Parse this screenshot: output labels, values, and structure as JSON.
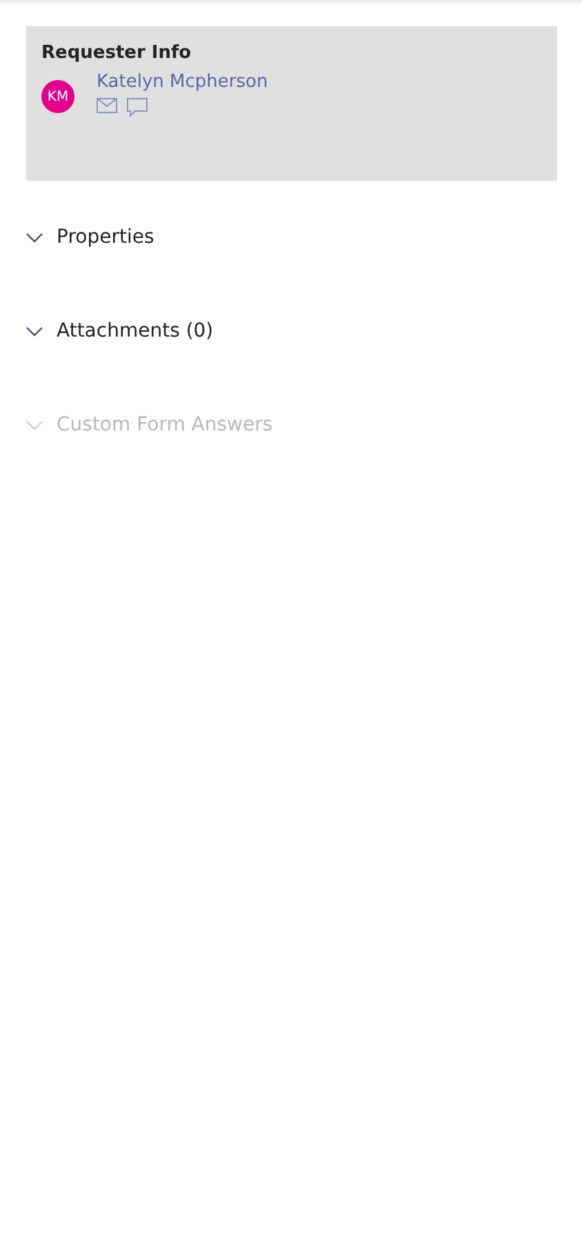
{
  "requester": {
    "title": "Requester Info",
    "initials": "KM",
    "name": "Katelyn Mcpherson"
  },
  "sections": [
    {
      "label": "Properties",
      "disabled": false
    },
    {
      "label": "Attachments (0)",
      "disabled": false
    },
    {
      "label": "Custom Form Answers",
      "disabled": true
    }
  ]
}
